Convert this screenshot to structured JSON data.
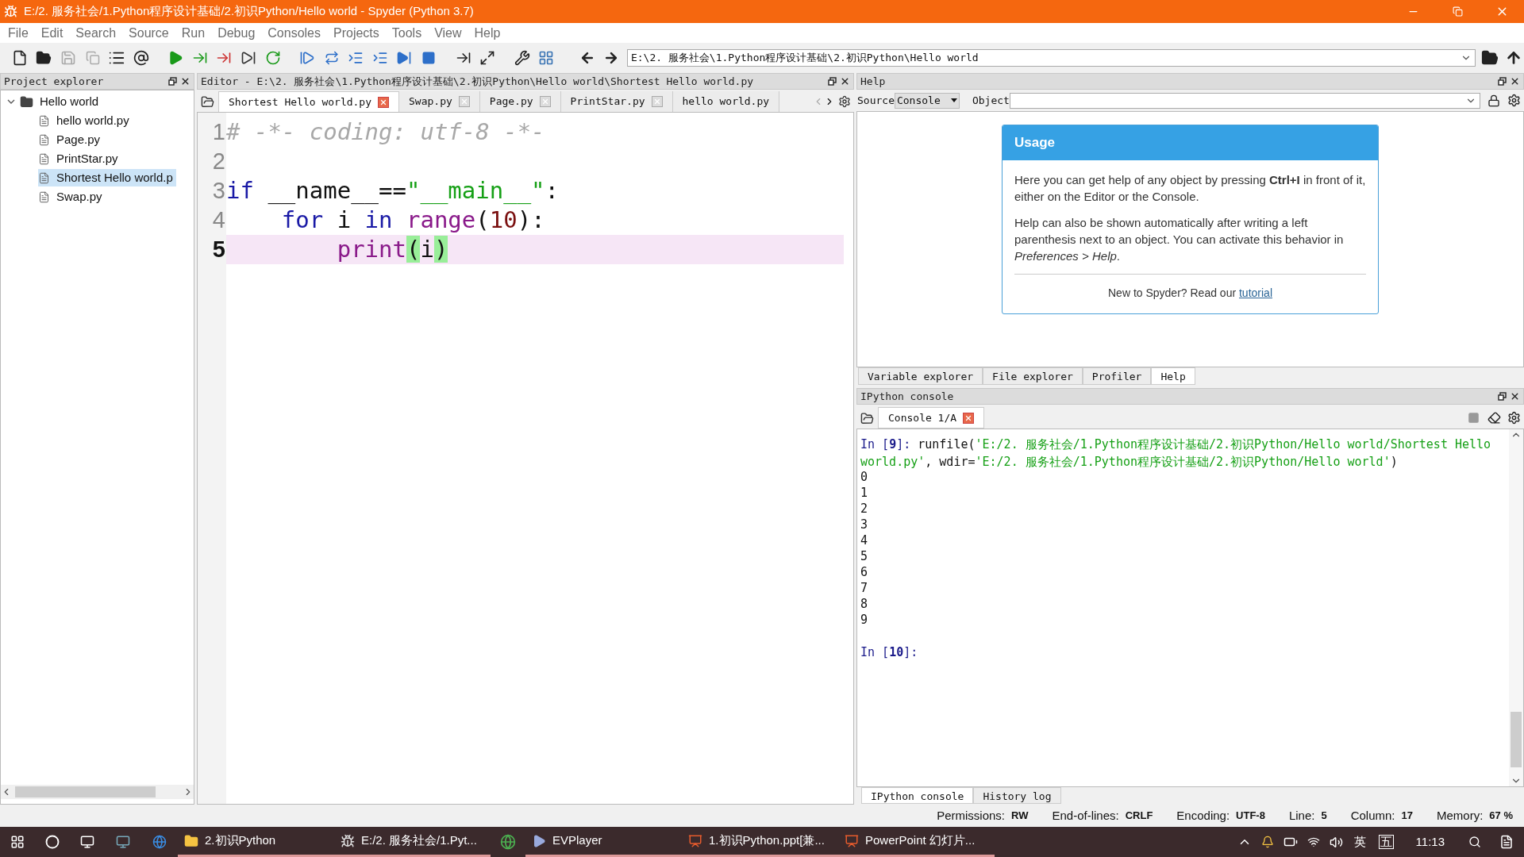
{
  "window": {
    "title": "E:/2. 服务社会/1.Python程序设计基础/2.初识Python/Hello world - Spyder (Python 3.7)"
  },
  "menu": [
    "File",
    "Edit",
    "Search",
    "Source",
    "Run",
    "Debug",
    "Consoles",
    "Projects",
    "Tools",
    "View",
    "Help"
  ],
  "path_field": {
    "value": "E:\\2.  服务社会\\1.Python程序设计基础\\2.初识Python\\Hello world"
  },
  "project_explorer": {
    "title": "Project explorer",
    "tree": [
      {
        "label": "Hello world",
        "kind": "folder",
        "expanded": true,
        "selected": false,
        "children": [
          {
            "label": "hello world.py",
            "kind": "file",
            "selected": false
          },
          {
            "label": "Page.py",
            "kind": "file",
            "selected": false
          },
          {
            "label": "PrintStar.py",
            "kind": "file",
            "selected": false
          },
          {
            "label": "Shortest Hello world.p",
            "kind": "file",
            "selected": true
          },
          {
            "label": "Swap.py",
            "kind": "file",
            "selected": false
          }
        ]
      }
    ]
  },
  "editor": {
    "title": "Editor - E:\\2.  服务社会\\1.Python程序设计基础\\2.初识Python\\Hello world\\Shortest Hello world.py",
    "tabs": [
      {
        "label": "Shortest Hello world.py",
        "selected": true
      },
      {
        "label": "Swap.py",
        "selected": false
      },
      {
        "label": "Page.py",
        "selected": false
      },
      {
        "label": "PrintStar.py",
        "selected": false
      },
      {
        "label": "hello world.py",
        "selected": false
      }
    ],
    "lines": [
      {
        "number": "1",
        "current": false,
        "tokens": [
          {
            "kind": "comment",
            "text": "# -*- coding: utf-8 -*-"
          }
        ]
      },
      {
        "number": "2",
        "current": false
      },
      {
        "number": "3",
        "current": false,
        "tokens": [
          {
            "kind": "keyword",
            "text": "if"
          },
          {
            "kind": "plain",
            "text": " __name__=="
          },
          {
            "kind": "string",
            "text": "\"__main__\""
          },
          {
            "kind": "plain",
            "text": ":"
          }
        ]
      },
      {
        "number": "4",
        "current": false,
        "tokens": [
          {
            "kind": "keyword",
            "text": "    for"
          },
          {
            "kind": "plain",
            "text": " i "
          },
          {
            "kind": "keyword",
            "text": "in"
          },
          {
            "kind": "builtin",
            "text": " range"
          },
          {
            "kind": "plain",
            "text": "("
          },
          {
            "kind": "number",
            "text": "10"
          },
          {
            "kind": "plain",
            "text": "):"
          }
        ]
      },
      {
        "number": "5",
        "current": true,
        "tokens": [
          {
            "kind": "builtin",
            "text": "        print"
          },
          {
            "kind": "match",
            "text": "("
          },
          {
            "kind": "plain",
            "text": "i"
          },
          {
            "kind": "match",
            "text": ")"
          }
        ]
      }
    ]
  },
  "help": {
    "title": "Help",
    "source_label": "Source",
    "source_value": "Console",
    "object_label": "Object",
    "card": {
      "title": "Usage",
      "paragraphs": [
        "Here you can get help of any object by pressing **Ctrl+I** in front of it, either on the Editor or the Console.",
        "Help can also be shown automatically after writing a left parenthesis next to an object. You can activate this behavior in *Preferences > Help*."
      ],
      "footer": "New to Spyder? Read our",
      "link": "tutorial"
    },
    "tabs": [
      {
        "label": "Variable explorer",
        "selected": false
      },
      {
        "label": "File explorer",
        "selected": false
      },
      {
        "label": "Profiler",
        "selected": false
      },
      {
        "label": "Help",
        "selected": true
      }
    ]
  },
  "console": {
    "title": "IPython console",
    "tabs": [
      {
        "label": "Console 1/A",
        "selected": true
      }
    ],
    "entries": [
      {
        "kind": "input",
        "prompt": "In [**9**]:",
        "segments": [
          {
            "kind": "plain",
            "text": "runfile("
          },
          {
            "kind": "string",
            "text": "'E:/2. 服务社会/1.Python程序设计基础/2.初识Python/Hello world/Shortest Hello world.py'"
          },
          {
            "kind": "plain",
            "text": ", wdir="
          },
          {
            "kind": "string",
            "text": "'E:/2. 服务社会/1.Python程序设计基础/2.初识Python/Hello world'"
          },
          {
            "kind": "plain",
            "text": ")"
          }
        ]
      },
      {
        "kind": "output",
        "text": "0"
      },
      {
        "kind": "output",
        "text": "1"
      },
      {
        "kind": "output",
        "text": "2"
      },
      {
        "kind": "output",
        "text": "3"
      },
      {
        "kind": "output",
        "text": "4"
      },
      {
        "kind": "output",
        "text": "5"
      },
      {
        "kind": "output",
        "text": "6"
      },
      {
        "kind": "output",
        "text": "7"
      },
      {
        "kind": "output",
        "text": "8"
      },
      {
        "kind": "output",
        "text": "9"
      },
      {
        "kind": "blank"
      },
      {
        "kind": "input",
        "prompt": "In [**10**]:"
      }
    ],
    "bottom_tabs": [
      {
        "label": "IPython console",
        "selected": true
      },
      {
        "label": "History log",
        "selected": false
      }
    ]
  },
  "status_bar": [
    {
      "label": "Permissions:",
      "value": "RW"
    },
    {
      "label": "End-of-lines:",
      "value": "CRLF"
    },
    {
      "label": "Encoding:",
      "value": "UTF-8"
    },
    {
      "label": "Line:",
      "value": "5"
    },
    {
      "label": "Column:",
      "value": "17"
    },
    {
      "label": "Memory:",
      "value": "67 %"
    }
  ],
  "taskbar": {
    "items": [
      {
        "kind": "folder",
        "label": "2.初识Python",
        "active": true
      },
      {
        "kind": "spyder",
        "label": "E:/2. 服务社会/1.Pyt...",
        "active": true
      },
      {
        "kind": "browser",
        "active": false
      },
      {
        "kind": "player",
        "label": "EVPlayer",
        "active": true
      },
      {
        "kind": "ppt",
        "label": "1.初识Python.ppt[兼...",
        "active": true
      },
      {
        "kind": "ppt",
        "label": "PowerPoint 幻灯片...",
        "active": true
      }
    ],
    "input_lang": "英",
    "ime": "五",
    "time": "11:13"
  }
}
